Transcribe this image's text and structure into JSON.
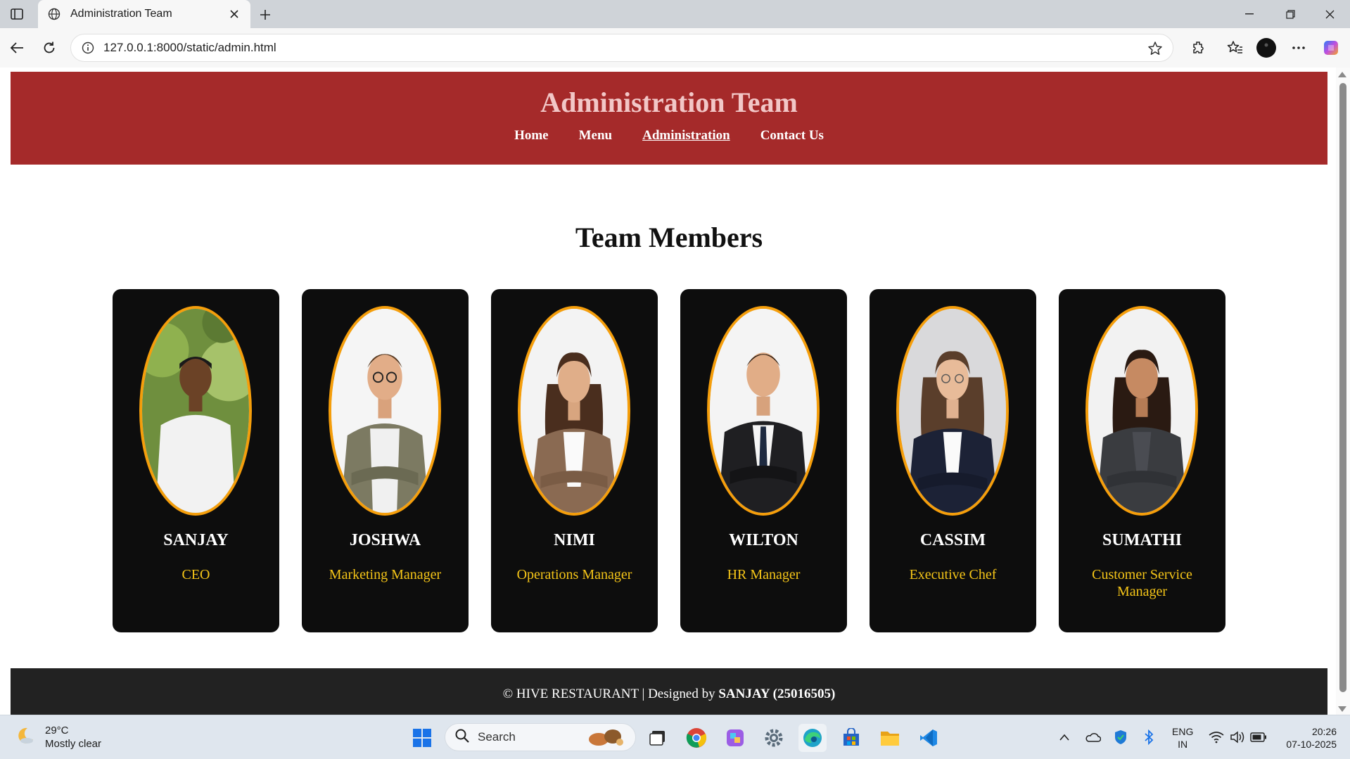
{
  "browser": {
    "tab_title": "Administration Team",
    "url": "127.0.0.1:8000/static/admin.html"
  },
  "header": {
    "title": "Administration Team",
    "nav": [
      {
        "label": "Home"
      },
      {
        "label": "Menu"
      },
      {
        "label": "Administration",
        "active": true
      },
      {
        "label": "Contact Us"
      }
    ]
  },
  "main": {
    "section_title": "Team Members",
    "members": [
      {
        "name": "SANJAY",
        "role": "CEO"
      },
      {
        "name": "JOSHWA",
        "role": "Marketing Manager"
      },
      {
        "name": "NIMI",
        "role": "Operations Manager"
      },
      {
        "name": "WILTON",
        "role": "HR Manager"
      },
      {
        "name": "CASSIM",
        "role": "Executive Chef"
      },
      {
        "name": "SUMATHI",
        "role": "Customer Service Manager"
      }
    ]
  },
  "footer": {
    "prefix": "© HIVE RESTAURANT | Designed by ",
    "author": "SANJAY (25016505)"
  },
  "taskbar": {
    "weather_temp": "29°C",
    "weather_desc": "Mostly clear",
    "search_placeholder": "Search",
    "lang_line1": "ENG",
    "lang_line2": "IN",
    "time": "20:26",
    "date": "07-10-2025"
  },
  "colors": {
    "header_bg": "#a52a2a",
    "card_bg": "#0d0d0d",
    "avatar_border": "#f59e0b",
    "role_text": "#f5c518",
    "footer_bg": "#222222"
  }
}
